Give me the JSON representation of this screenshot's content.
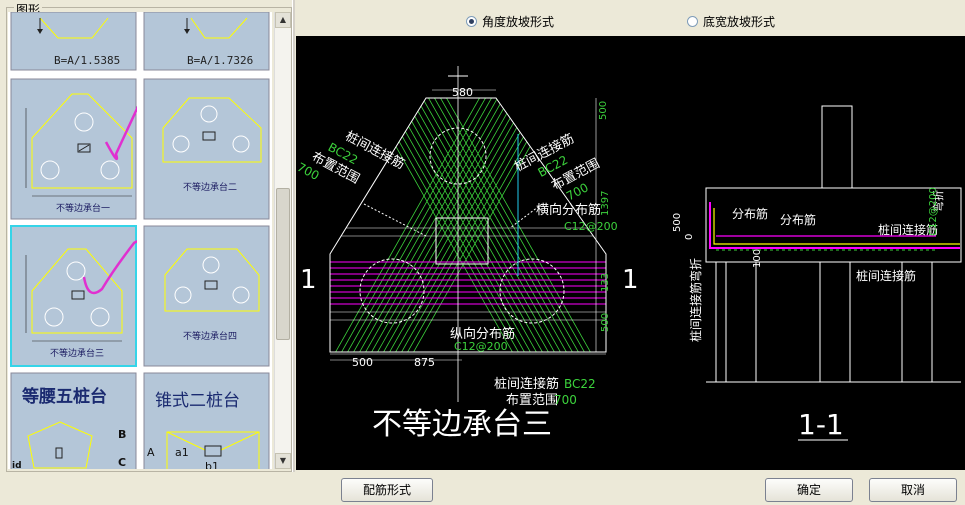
{
  "left_panel": {
    "group_title": "图形",
    "thumbnails": [
      {
        "id": "t1",
        "formula": "B=A/1.5385"
      },
      {
        "id": "t2",
        "formula": "B=A/1.7326"
      },
      {
        "id": "t3",
        "label": "不等边承台一"
      },
      {
        "id": "t4",
        "label": "不等边承台二"
      },
      {
        "id": "t5",
        "label": "不等边承台三"
      },
      {
        "id": "t6",
        "label": "不等边承台四"
      },
      {
        "id": "t7",
        "label": "等腰五桩台"
      },
      {
        "id": "t8",
        "label": "锥式二桩台"
      }
    ]
  },
  "options": {
    "angle": "角度放坡形式",
    "width": "底宽放坡形式",
    "selected": "angle"
  },
  "drawing": {
    "plan": {
      "title": "不等边承台三",
      "dim_top": "580",
      "dim_500_left": "500",
      "dim_875": "875",
      "dim_500_right_v": "500",
      "dim_1397": "1397",
      "dim_133": "133",
      "dim_500_bot_v": "500",
      "section_mark": "1",
      "zhuangjian_lianjie": "桩间连接筋",
      "bu_zhi_fanwei": "布置范围",
      "bc22": "BC22",
      "v700": "700",
      "hengxiang": "横向分布筋",
      "c12_200": "C12@200",
      "zongxiang": "纵向分布筋"
    },
    "section": {
      "title": "1-1",
      "fenbu": "分布筋",
      "zhuangjian": "桩间连接筋",
      "wanzhe": "弯折",
      "dim_500": "500",
      "dim_0": "0",
      "dim_100": "100",
      "v_anchor": "桩间连接筋弯折"
    }
  },
  "buttons": {
    "rebar_form": "配筋形式",
    "ok": "确定",
    "cancel": "取消"
  },
  "colors": {
    "background": "#ece9d8",
    "canvas": "#000000",
    "thumb_bg": "#b4c6d8",
    "selection": "#35d4e8",
    "rebar_green": "#3cd23c",
    "rebar_magenta": "#ff00ff",
    "annotation_green": "#00c800",
    "yellow": "#ffff00"
  }
}
